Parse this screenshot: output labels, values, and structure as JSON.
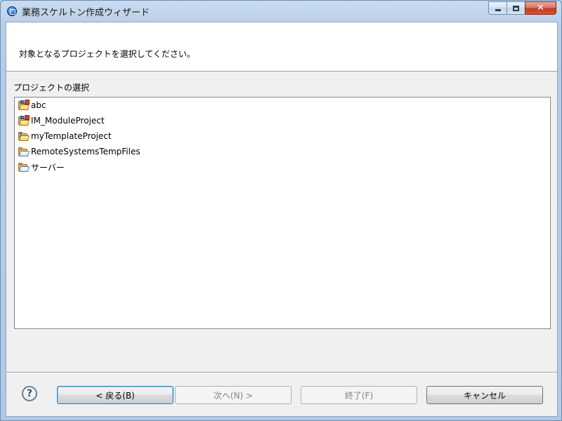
{
  "window": {
    "title": "業務スケルトン作成ウィザード"
  },
  "header": {
    "message": "対象となるプロジェクトを選択してください。"
  },
  "projects": {
    "label": "プロジェクトの選択",
    "items": [
      {
        "name": "abc",
        "icon": "java-project-icon"
      },
      {
        "name": "IM_ModuleProject",
        "icon": "java-project-icon"
      },
      {
        "name": "myTemplateProject",
        "icon": "java-project-icon"
      },
      {
        "name": "RemoteSystemsTempFiles",
        "icon": "open-folder-icon"
      },
      {
        "name": "サーバー",
        "icon": "open-folder-icon"
      }
    ]
  },
  "buttons": {
    "help": "?",
    "back": "< 戻る(B)",
    "next": "次へ(N) >",
    "finish": "終了(F)",
    "cancel": "キャンセル"
  }
}
